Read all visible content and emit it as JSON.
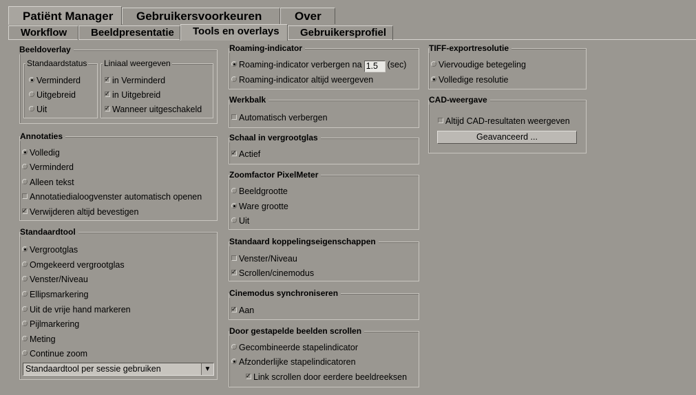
{
  "main_tabs": [
    "Patiënt Manager",
    "Gebruikersvoorkeuren",
    "Over"
  ],
  "sub_tabs": [
    "Workflow",
    "Beeldpresentatie",
    "Tools en overlays",
    "Gebruikersprofiel"
  ],
  "beeldoverlay": {
    "title": "Beeldoverlay",
    "standaardstatus": {
      "title": "Standaardstatus",
      "options": [
        "Verminderd",
        "Uitgebreid",
        "Uit"
      ],
      "selected": "Verminderd"
    },
    "liniaal": {
      "title": "Liniaal weergeven",
      "options": [
        "in Verminderd",
        "in Uitgebreid",
        "Wanneer uitgeschakeld"
      ],
      "checked": [
        true,
        true,
        true
      ]
    }
  },
  "annotaties": {
    "title": "Annotaties",
    "radios": [
      "Volledig",
      "Verminderd",
      "Alleen tekst"
    ],
    "selected": "Volledig",
    "checks": [
      "Annotatiedialoogvenster automatisch openen",
      "Verwijderen altijd bevestigen"
    ],
    "checked": [
      false,
      true
    ]
  },
  "standaardtool": {
    "title": "Standaardtool",
    "options": [
      "Vergrootglas",
      "Omgekeerd vergrootglas",
      "Venster/Niveau",
      "Ellipsmarkering",
      "Uit de vrije hand markeren",
      "Pijlmarkering",
      "Meting",
      "Continue zoom"
    ],
    "selected": "Vergrootglas",
    "dropdown_value": "Standaardtool per sessie gebruiken"
  },
  "roaming": {
    "title": "Roaming-indicator",
    "option1_prefix": "Roaming-indicator verbergen na",
    "seconds_value": "1.5",
    "option1_suffix": "(sec)",
    "option2": "Roaming-indicator altijd weergeven",
    "selected": 1
  },
  "werkbalk": {
    "title": "Werkbalk",
    "check": "Automatisch verbergen",
    "checked": false
  },
  "schaal": {
    "title": "Schaal in vergrootglas",
    "check": "Actief",
    "checked": true
  },
  "zoomfactor": {
    "title": "Zoomfactor PixelMeter",
    "options": [
      "Beeldgrootte",
      "Ware grootte",
      "Uit"
    ],
    "selected": "Ware grootte"
  },
  "koppeling": {
    "title": "Standaard koppelingseigenschappen",
    "checks": [
      "Venster/Niveau",
      "Scrollen/cinemodus"
    ],
    "checked": [
      false,
      true
    ]
  },
  "cinemodus": {
    "title": "Cinemodus synchroniseren",
    "check": "Aan",
    "checked": true
  },
  "stapel": {
    "title": "Door gestapelde beelden scrollen",
    "options": [
      "Gecombineerde stapelindicator",
      "Afzonderlijke stapelindicatoren"
    ],
    "selected": "Afzonderlijke stapelindicatoren",
    "sub_check": "Link scrollen door eerdere beeldreeksen",
    "sub_checked": true
  },
  "tiff": {
    "title": "TIFF-exportresolutie",
    "options": [
      "Viervoudige betegeling",
      "Volledige resolutie"
    ],
    "selected": "Volledige resolutie"
  },
  "cad": {
    "title": "CAD-weergave",
    "check": "Altijd CAD-resultaten weergeven",
    "checked": false,
    "button": "Geavanceerd ..."
  }
}
